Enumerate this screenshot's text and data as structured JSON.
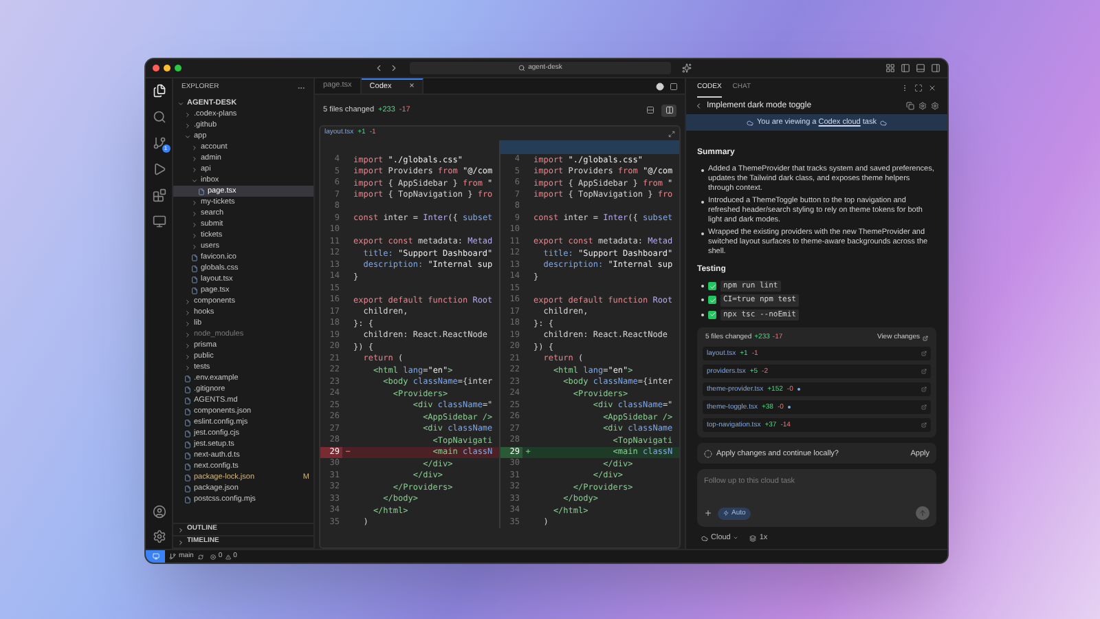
{
  "titlebar": {
    "search_value": "agent-desk"
  },
  "activity_bar": [
    {
      "kind": "files",
      "selected": true
    },
    {
      "kind": "search",
      "selected": false
    },
    {
      "kind": "git",
      "selected": false,
      "badge": "1"
    },
    {
      "kind": "run",
      "selected": false
    },
    {
      "kind": "extensions",
      "selected": false
    },
    {
      "kind": "remote",
      "selected": false
    }
  ],
  "activity_bottom": [
    {
      "kind": "account"
    },
    {
      "kind": "settings"
    }
  ],
  "explorer": {
    "title": "EXPLORER",
    "tree": [
      {
        "kind": "folder",
        "label": "AGENT-DESK",
        "expanded": true,
        "selected": false,
        "children": [
          {
            "kind": "folder",
            "label": ".codex-plans",
            "expanded": false,
            "selected": false
          },
          {
            "kind": "folder",
            "label": ".github",
            "expanded": false,
            "selected": false
          },
          {
            "kind": "folder",
            "label": "app",
            "expanded": true,
            "selected": false,
            "children": [
              {
                "kind": "folder",
                "label": "account",
                "expanded": false,
                "selected": false
              },
              {
                "kind": "folder",
                "label": "admin",
                "expanded": false,
                "selected": false
              },
              {
                "kind": "folder",
                "label": "api",
                "expanded": false,
                "selected": false
              },
              {
                "kind": "folder",
                "label": "inbox",
                "expanded": true,
                "selected": false,
                "children": [
                  {
                    "kind": "file",
                    "label": "page.tsx",
                    "selected": true
                  }
                ]
              },
              {
                "kind": "folder",
                "label": "my-tickets",
                "expanded": false,
                "selected": false
              },
              {
                "kind": "folder",
                "label": "search",
                "expanded": false,
                "selected": false
              },
              {
                "kind": "folder",
                "label": "submit",
                "expanded": false,
                "selected": false
              },
              {
                "kind": "folder",
                "label": "tickets",
                "expanded": false,
                "selected": false
              },
              {
                "kind": "folder",
                "label": "users",
                "expanded": false,
                "selected": false
              },
              {
                "kind": "file",
                "label": "favicon.ico",
                "selected": false
              },
              {
                "kind": "file",
                "label": "globals.css",
                "selected": false
              },
              {
                "kind": "file",
                "label": "layout.tsx",
                "selected": false
              },
              {
                "kind": "file",
                "label": "page.tsx",
                "selected": false
              }
            ]
          },
          {
            "kind": "folder",
            "label": "components",
            "expanded": false,
            "selected": false
          },
          {
            "kind": "folder",
            "label": "hooks",
            "expanded": false,
            "selected": false
          },
          {
            "kind": "folder",
            "label": "lib",
            "expanded": false,
            "selected": false
          },
          {
            "kind": "folder",
            "label": "node_modules",
            "expanded": false,
            "selected": false,
            "dimmed": true
          },
          {
            "kind": "folder",
            "label": "prisma",
            "expanded": false,
            "selected": false
          },
          {
            "kind": "folder",
            "label": "public",
            "expanded": false,
            "selected": false
          },
          {
            "kind": "folder",
            "label": "tests",
            "expanded": false,
            "selected": false
          },
          {
            "kind": "file",
            "label": ".env.example",
            "selected": false
          },
          {
            "kind": "file",
            "label": ".gitignore",
            "selected": false
          },
          {
            "kind": "file",
            "label": "AGENTS.md",
            "selected": false
          },
          {
            "kind": "file",
            "label": "components.json",
            "selected": false
          },
          {
            "kind": "file",
            "label": "eslint.config.mjs",
            "selected": false
          },
          {
            "kind": "file",
            "label": "jest.config.cjs",
            "selected": false
          },
          {
            "kind": "file",
            "label": "jest.setup.ts",
            "selected": false
          },
          {
            "kind": "file",
            "label": "next-auth.d.ts",
            "selected": false
          },
          {
            "kind": "file",
            "label": "next.config.ts",
            "selected": false
          },
          {
            "kind": "file",
            "label": "package-lock.json",
            "selected": false,
            "badge": "M"
          },
          {
            "kind": "file",
            "label": "package.json",
            "selected": false
          },
          {
            "kind": "file",
            "label": "postcss.config.mjs",
            "selected": false
          }
        ]
      }
    ],
    "sections": [
      {
        "label": "OUTLINE",
        "expanded": false
      },
      {
        "label": "TIMELINE",
        "expanded": false
      }
    ]
  },
  "editor": {
    "tabs": [
      {
        "label": "page.tsx",
        "selected": false
      },
      {
        "label": "Codex",
        "selected": true,
        "close": "×"
      }
    ],
    "summary": {
      "text": "5 files changed",
      "added": "+233",
      "removed": "-17"
    },
    "view_modes": [
      {
        "kind": "inline",
        "selected": false
      },
      {
        "kind": "split",
        "selected": true
      }
    ],
    "file": {
      "name": "layout.tsx",
      "added": "+1",
      "removed": "-1"
    },
    "panes": [
      {
        "lines": [
          {
            "number": "4",
            "kind": "context",
            "segments": [
              {
                "kind": "kw",
                "text": "import "
              },
              {
                "kind": "str",
                "text": "\"./globals.css\""
              }
            ]
          },
          {
            "number": "5",
            "kind": "context",
            "segments": [
              {
                "kind": "kw",
                "text": "import "
              },
              {
                "kind": "pl",
                "text": "Providers "
              },
              {
                "kind": "kw",
                "text": "from "
              },
              {
                "kind": "str",
                "text": "\"@/com"
              }
            ]
          },
          {
            "number": "6",
            "kind": "context",
            "segments": [
              {
                "kind": "kw",
                "text": "import "
              },
              {
                "kind": "pl",
                "text": "{ AppSidebar } "
              },
              {
                "kind": "kw",
                "text": "from "
              },
              {
                "kind": "str",
                "text": "\""
              }
            ]
          },
          {
            "number": "7",
            "kind": "context",
            "segments": [
              {
                "kind": "kw",
                "text": "import "
              },
              {
                "kind": "pl",
                "text": "{ TopNavigation } "
              },
              {
                "kind": "kw",
                "text": "fro"
              }
            ]
          },
          {
            "number": "8",
            "kind": "context"
          },
          {
            "number": "9",
            "kind": "context",
            "segments": [
              {
                "kind": "kw",
                "text": "const "
              },
              {
                "kind": "pl",
                "text": "inter = "
              },
              {
                "kind": "fn",
                "text": "Inter"
              },
              {
                "kind": "pl",
                "text": "({ "
              },
              {
                "kind": "attr",
                "text": "subset"
              }
            ]
          },
          {
            "number": "10",
            "kind": "context"
          },
          {
            "number": "11",
            "kind": "context",
            "segments": [
              {
                "kind": "kw",
                "text": "export const "
              },
              {
                "kind": "pl",
                "text": "metadata: "
              },
              {
                "kind": "fn",
                "text": "Metad"
              }
            ]
          },
          {
            "number": "12",
            "kind": "context",
            "segments": [
              {
                "kind": "attr",
                "text": "  title: "
              },
              {
                "kind": "str",
                "text": "\"Support Dashboard\""
              }
            ]
          },
          {
            "number": "13",
            "kind": "context",
            "segments": [
              {
                "kind": "attr",
                "text": "  description: "
              },
              {
                "kind": "str",
                "text": "\"Internal sup"
              }
            ]
          },
          {
            "number": "14",
            "kind": "context",
            "segments": [
              {
                "kind": "pl",
                "text": "}"
              }
            ]
          },
          {
            "number": "15",
            "kind": "context"
          },
          {
            "number": "16",
            "kind": "context",
            "segments": [
              {
                "kind": "kw",
                "text": "export default function "
              },
              {
                "kind": "fn",
                "text": "Root"
              }
            ]
          },
          {
            "number": "17",
            "kind": "context",
            "segments": [
              {
                "kind": "pl",
                "text": "  children,"
              }
            ]
          },
          {
            "number": "18",
            "kind": "context",
            "segments": [
              {
                "kind": "pl",
                "text": "}: {"
              }
            ]
          },
          {
            "number": "19",
            "kind": "context",
            "segments": [
              {
                "kind": "pl",
                "text": "  children: React.ReactNode"
              }
            ]
          },
          {
            "number": "20",
            "kind": "context",
            "segments": [
              {
                "kind": "pl",
                "text": "}) {"
              }
            ]
          },
          {
            "number": "21",
            "kind": "context",
            "segments": [
              {
                "kind": "kw",
                "text": "  return "
              },
              {
                "kind": "pl",
                "text": "("
              }
            ]
          },
          {
            "number": "22",
            "kind": "context",
            "segments": [
              {
                "kind": "tag",
                "text": "    <html "
              },
              {
                "kind": "attr",
                "text": "lang"
              },
              {
                "kind": "pl",
                "text": "="
              },
              {
                "kind": "str",
                "text": "\"en\""
              },
              {
                "kind": "tag",
                "text": ">"
              }
            ]
          },
          {
            "number": "23",
            "kind": "context",
            "segments": [
              {
                "kind": "tag",
                "text": "      <body "
              },
              {
                "kind": "attr",
                "text": "className"
              },
              {
                "kind": "pl",
                "text": "={inter"
              }
            ]
          },
          {
            "number": "24",
            "kind": "context",
            "segments": [
              {
                "kind": "tag",
                "text": "        <Providers>"
              }
            ]
          },
          {
            "number": "25",
            "kind": "context",
            "segments": [
              {
                "kind": "tag",
                "text": "            <div "
              },
              {
                "kind": "attr",
                "text": "className"
              },
              {
                "kind": "pl",
                "text": "=\""
              }
            ]
          },
          {
            "number": "26",
            "kind": "context",
            "segments": [
              {
                "kind": "tag",
                "text": "              <AppSidebar />"
              }
            ]
          },
          {
            "number": "27",
            "kind": "context",
            "segments": [
              {
                "kind": "tag",
                "text": "              <div "
              },
              {
                "kind": "attr",
                "text": "className"
              }
            ]
          },
          {
            "number": "28",
            "kind": "context",
            "segments": [
              {
                "kind": "tag",
                "text": "                <TopNavigati"
              }
            ]
          },
          {
            "number": "29",
            "kind": "removed",
            "marker": "−",
            "segments": [
              {
                "kind": "tag",
                "text": "                <main "
              },
              {
                "kind": "attr",
                "text": "classN"
              }
            ]
          },
          {
            "number": "30",
            "kind": "context",
            "segments": [
              {
                "kind": "tag",
                "text": "              </div>"
              }
            ]
          },
          {
            "number": "31",
            "kind": "context",
            "segments": [
              {
                "kind": "tag",
                "text": "            </div>"
              }
            ]
          },
          {
            "number": "32",
            "kind": "context",
            "segments": [
              {
                "kind": "tag",
                "text": "        </Providers>"
              }
            ]
          },
          {
            "number": "33",
            "kind": "context",
            "segments": [
              {
                "kind": "tag",
                "text": "      </body>"
              }
            ]
          },
          {
            "number": "34",
            "kind": "context",
            "segments": [
              {
                "kind": "tag",
                "text": "    </html>"
              }
            ]
          },
          {
            "number": "35",
            "kind": "context",
            "segments": [
              {
                "kind": "pl",
                "text": "  )"
              }
            ]
          }
        ]
      },
      {
        "lines": [
          {
            "number": "4",
            "kind": "context",
            "segments": [
              {
                "kind": "kw",
                "text": "import "
              },
              {
                "kind": "str",
                "text": "\"./globals.css\""
              }
            ]
          },
          {
            "number": "5",
            "kind": "context",
            "segments": [
              {
                "kind": "kw",
                "text": "import "
              },
              {
                "kind": "pl",
                "text": "Providers "
              },
              {
                "kind": "kw",
                "text": "from "
              },
              {
                "kind": "str",
                "text": "\"@/com"
              }
            ]
          },
          {
            "number": "6",
            "kind": "context",
            "segments": [
              {
                "kind": "kw",
                "text": "import "
              },
              {
                "kind": "pl",
                "text": "{ AppSidebar } "
              },
              {
                "kind": "kw",
                "text": "from "
              },
              {
                "kind": "str",
                "text": "\""
              }
            ]
          },
          {
            "number": "7",
            "kind": "context",
            "segments": [
              {
                "kind": "kw",
                "text": "import "
              },
              {
                "kind": "pl",
                "text": "{ TopNavigation } "
              },
              {
                "kind": "kw",
                "text": "fro"
              }
            ]
          },
          {
            "number": "8",
            "kind": "context"
          },
          {
            "number": "9",
            "kind": "context",
            "segments": [
              {
                "kind": "kw",
                "text": "const "
              },
              {
                "kind": "pl",
                "text": "inter = "
              },
              {
                "kind": "fn",
                "text": "Inter"
              },
              {
                "kind": "pl",
                "text": "({ "
              },
              {
                "kind": "attr",
                "text": "subset"
              }
            ]
          },
          {
            "number": "10",
            "kind": "context"
          },
          {
            "number": "11",
            "kind": "context",
            "segments": [
              {
                "kind": "kw",
                "text": "export const "
              },
              {
                "kind": "pl",
                "text": "metadata: "
              },
              {
                "kind": "fn",
                "text": "Metad"
              }
            ]
          },
          {
            "number": "12",
            "kind": "context",
            "segments": [
              {
                "kind": "attr",
                "text": "  title: "
              },
              {
                "kind": "str",
                "text": "\"Support Dashboard\""
              }
            ]
          },
          {
            "number": "13",
            "kind": "context",
            "segments": [
              {
                "kind": "attr",
                "text": "  description: "
              },
              {
                "kind": "str",
                "text": "\"Internal sup"
              }
            ]
          },
          {
            "number": "14",
            "kind": "context",
            "segments": [
              {
                "kind": "pl",
                "text": "}"
              }
            ]
          },
          {
            "number": "15",
            "kind": "context"
          },
          {
            "number": "16",
            "kind": "context",
            "segments": [
              {
                "kind": "kw",
                "text": "export default function "
              },
              {
                "kind": "fn",
                "text": "Root"
              }
            ]
          },
          {
            "number": "17",
            "kind": "context",
            "segments": [
              {
                "kind": "pl",
                "text": "  children,"
              }
            ]
          },
          {
            "number": "18",
            "kind": "context",
            "segments": [
              {
                "kind": "pl",
                "text": "}: {"
              }
            ]
          },
          {
            "number": "19",
            "kind": "context",
            "segments": [
              {
                "kind": "pl",
                "text": "  children: React.ReactNode"
              }
            ]
          },
          {
            "number": "20",
            "kind": "context",
            "segments": [
              {
                "kind": "pl",
                "text": "}) {"
              }
            ]
          },
          {
            "number": "21",
            "kind": "context",
            "segments": [
              {
                "kind": "kw",
                "text": "  return "
              },
              {
                "kind": "pl",
                "text": "("
              }
            ]
          },
          {
            "number": "22",
            "kind": "context",
            "segments": [
              {
                "kind": "tag",
                "text": "    <html "
              },
              {
                "kind": "attr",
                "text": "lang"
              },
              {
                "kind": "pl",
                "text": "="
              },
              {
                "kind": "str",
                "text": "\"en\""
              },
              {
                "kind": "tag",
                "text": ">"
              }
            ]
          },
          {
            "number": "23",
            "kind": "context",
            "segments": [
              {
                "kind": "tag",
                "text": "      <body "
              },
              {
                "kind": "attr",
                "text": "className"
              },
              {
                "kind": "pl",
                "text": "={inter"
              }
            ]
          },
          {
            "number": "24",
            "kind": "context",
            "segments": [
              {
                "kind": "tag",
                "text": "        <Providers>"
              }
            ]
          },
          {
            "number": "25",
            "kind": "context",
            "segments": [
              {
                "kind": "tag",
                "text": "            <div "
              },
              {
                "kind": "attr",
                "text": "className"
              },
              {
                "kind": "pl",
                "text": "=\""
              }
            ]
          },
          {
            "number": "26",
            "kind": "context",
            "segments": [
              {
                "kind": "tag",
                "text": "              <AppSidebar />"
              }
            ]
          },
          {
            "number": "27",
            "kind": "context",
            "segments": [
              {
                "kind": "tag",
                "text": "              <div "
              },
              {
                "kind": "attr",
                "text": "className"
              }
            ]
          },
          {
            "number": "28",
            "kind": "context",
            "segments": [
              {
                "kind": "tag",
                "text": "                <TopNavigati"
              }
            ]
          },
          {
            "number": "29",
            "kind": "added",
            "marker": "+",
            "segments": [
              {
                "kind": "tag",
                "text": "                <main "
              },
              {
                "kind": "attr",
                "text": "classN"
              }
            ]
          },
          {
            "number": "30",
            "kind": "context",
            "segments": [
              {
                "kind": "tag",
                "text": "              </div>"
              }
            ]
          },
          {
            "number": "31",
            "kind": "context",
            "segments": [
              {
                "kind": "tag",
                "text": "            </div>"
              }
            ]
          },
          {
            "number": "32",
            "kind": "context",
            "segments": [
              {
                "kind": "tag",
                "text": "        </Providers>"
              }
            ]
          },
          {
            "number": "33",
            "kind": "context",
            "segments": [
              {
                "kind": "tag",
                "text": "      </body>"
              }
            ]
          },
          {
            "number": "34",
            "kind": "context",
            "segments": [
              {
                "kind": "tag",
                "text": "    </html>"
              }
            ]
          },
          {
            "number": "35",
            "kind": "context",
            "segments": [
              {
                "kind": "pl",
                "text": "  )"
              }
            ]
          }
        ]
      }
    ]
  },
  "panel": {
    "tabs": [
      {
        "label": "CODEX",
        "selected": true
      },
      {
        "label": "CHAT",
        "selected": false
      }
    ],
    "task_title": "Implement dark mode toggle",
    "banner": {
      "before": "You are viewing a ",
      "link": "Codex cloud",
      "after": " task"
    },
    "summary_heading": "Summary",
    "summary": [
      "Added a ThemeProvider that tracks system and saved preferences, updates the Tailwind dark class, and exposes theme helpers through context.",
      "Introduced a ThemeToggle button to the top navigation and refreshed header/search styling to rely on theme tokens for both light and dark modes.",
      "Wrapped the existing providers with the new ThemeProvider and switched layout surfaces to theme-aware backgrounds across the shell."
    ],
    "testing_heading": "Testing",
    "tests": [
      {
        "command": "npm run lint",
        "kind": "passed"
      },
      {
        "command": "CI=true npm test",
        "kind": "passed"
      },
      {
        "command": "npx tsc --noEmit",
        "kind": "passed"
      }
    ],
    "changes": {
      "text": "5 files changed",
      "added": "+233",
      "removed": "-17",
      "action": "View changes",
      "files": [
        {
          "name": "layout.tsx",
          "added": "+1",
          "removed": "-1",
          "new": false
        },
        {
          "name": "providers.tsx",
          "added": "+5",
          "removed": "-2",
          "new": false
        },
        {
          "name": "theme-provider.tsx",
          "added": "+152",
          "removed": "-0",
          "new": true
        },
        {
          "name": "theme-toggle.tsx",
          "added": "+38",
          "removed": "-0",
          "new": true
        },
        {
          "name": "top-navigation.tsx",
          "added": "+37",
          "removed": "-14",
          "new": false
        }
      ]
    },
    "apply": {
      "question": "Apply changes and continue locally?",
      "button": "Apply"
    },
    "composer": {
      "placeholder": "Follow up to this cloud task",
      "mode": "Auto"
    },
    "footer": {
      "environment": "Cloud",
      "count": "1x"
    }
  },
  "status_bar": {
    "branch": "main",
    "errors": "0",
    "warnings": "0"
  }
}
